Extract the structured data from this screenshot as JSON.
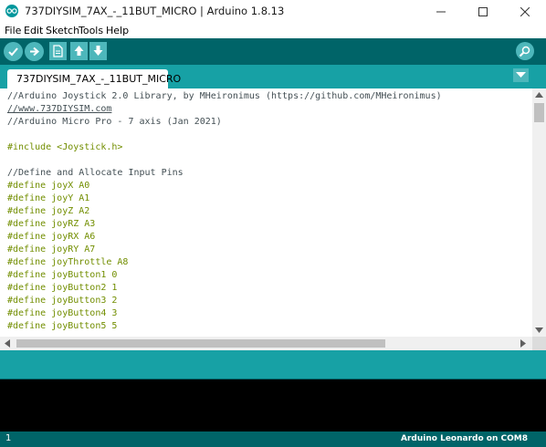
{
  "window": {
    "title": "737DIYSIM_7AX_-_11BUT_MICRO | Arduino 1.8.13",
    "app_icon": "arduino-logo-icon"
  },
  "menu": {
    "items": [
      "File",
      "Edit",
      "Sketch",
      "Tools",
      "Help"
    ]
  },
  "toolbar": {
    "buttons": [
      "verify-icon",
      "upload-icon",
      "new-icon",
      "open-icon",
      "save-icon"
    ],
    "right_button": "serial-monitor-icon"
  },
  "tabs": {
    "items": [
      {
        "label": "737DIYSIM_7AX_-_11BUT_MICRO"
      }
    ]
  },
  "editor": {
    "lines": [
      "//Arduino Joystick 2.0 Library, by MHeironimus (https://github.com/MHeironimus)",
      "//www.737DIYSIM.com",
      "//Arduino Micro Pro - 7 axis (Jan 2021)",
      "",
      "#include <Joystick.h>",
      "",
      "//Define and Allocate Input Pins",
      "#define joyX A0",
      "#define joyY A1",
      "#define joyZ A2",
      "#define joyRZ A3",
      "#define joyRX A6",
      "#define joyRY A7",
      "#define joyThrottle A8",
      "#define joyButton1 0",
      "#define joyButton2 1",
      "#define joyButton3 2",
      "#define joyButton4 3",
      "#define joyButton5 5"
    ]
  },
  "status": {
    "line_number": "1",
    "board": "Arduino Leonardo on COM8"
  },
  "colors": {
    "toolbar": "#006468",
    "tabbar": "#17a1a5",
    "button": "#4db7bb",
    "keyword": "#728e00",
    "comment": "#434f54"
  }
}
